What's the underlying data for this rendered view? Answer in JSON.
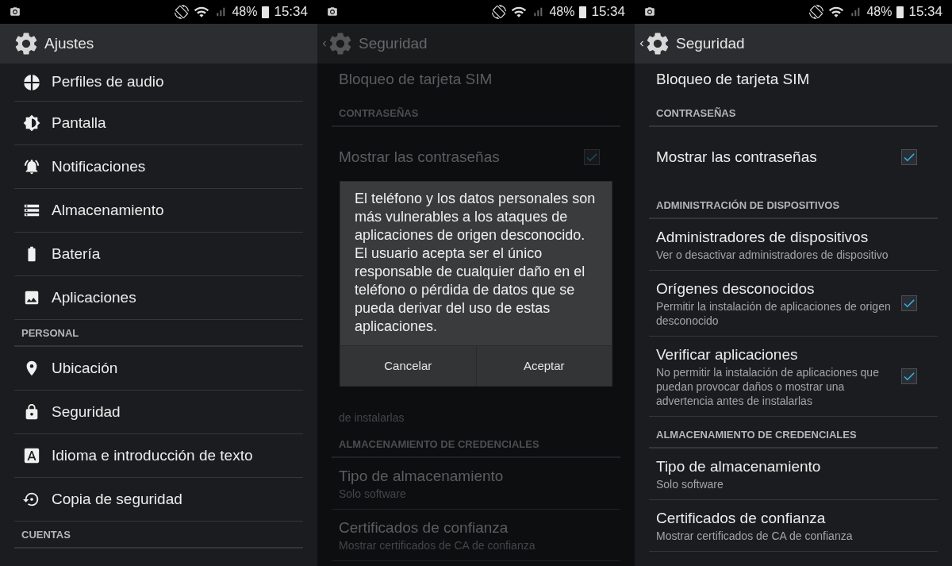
{
  "screens": [
    {
      "dimmed": false,
      "status_bar": {
        "battery": "48%",
        "time": "15:34"
      },
      "header": {
        "title": "Ajustes",
        "back": false
      },
      "items": [
        {
          "kind": "icon_row",
          "label": "Perfiles de audio"
        },
        {
          "kind": "icon_row",
          "label": "Pantalla"
        },
        {
          "kind": "icon_row",
          "label": "Notificaciones"
        },
        {
          "kind": "icon_row",
          "label": "Almacenamiento"
        },
        {
          "kind": "icon_row",
          "label": "Batería"
        },
        {
          "kind": "icon_row",
          "label": "Aplicaciones"
        },
        {
          "kind": "section",
          "label": "PERSONAL"
        },
        {
          "kind": "icon_row",
          "label": "Ubicación"
        },
        {
          "kind": "icon_row",
          "label": "Seguridad"
        },
        {
          "kind": "icon_row",
          "label": "Idioma e introducción de texto"
        },
        {
          "kind": "icon_row",
          "label": "Copia de seguridad"
        },
        {
          "kind": "section",
          "label": "CUENTAS"
        }
      ]
    },
    {
      "dimmed": true,
      "status_bar": {
        "battery": "48%",
        "time": "15:34"
      },
      "header": {
        "title": "Seguridad",
        "back": true
      },
      "items": [
        {
          "kind": "row",
          "label": "Bloqueo de tarjeta SIM"
        },
        {
          "kind": "section",
          "label": "CONTRASEÑAS"
        },
        {
          "kind": "check_row",
          "label": "Mostrar las contraseñas",
          "checked": true
        },
        {
          "kind": "fragment",
          "label": "de instalarlas"
        },
        {
          "kind": "section",
          "label": "ALMACENAMIENTO DE CREDENCIALES"
        },
        {
          "kind": "row",
          "label": "Tipo de almacenamiento",
          "summary": "Solo software"
        },
        {
          "kind": "row",
          "label": "Certificados de confianza",
          "summary": "Mostrar certificados de CA de confianza"
        }
      ],
      "dialog": {
        "message": "El teléfono y los datos personales son más vulnerables a los ataques de aplicaciones de origen desconocido. El usuario acepta ser el único responsable de cualquier daño en el teléfono o pérdida de datos que se pueda derivar del uso de estas aplicaciones.",
        "buttons": [
          "Cancelar",
          "Aceptar"
        ]
      }
    },
    {
      "dimmed": false,
      "status_bar": {
        "battery": "48%",
        "time": "15:34"
      },
      "header": {
        "title": "Seguridad",
        "back": true
      },
      "items": [
        {
          "kind": "row",
          "label": "Bloqueo de tarjeta SIM"
        },
        {
          "kind": "section",
          "label": "CONTRASEÑAS"
        },
        {
          "kind": "check_row",
          "label": "Mostrar las contraseñas",
          "checked": true
        },
        {
          "kind": "section",
          "label": "ADMINISTRACIÓN DE DISPOSITIVOS"
        },
        {
          "kind": "row",
          "label": "Administradores de dispositivos",
          "summary": "Ver o desactivar administradores de dispositivo"
        },
        {
          "kind": "check_row",
          "label": "Orígenes desconocidos",
          "summary": "Permitir la instalación de aplicaciones de origen desconocido",
          "checked": true
        },
        {
          "kind": "check_row",
          "label": "Verificar aplicaciones",
          "summary": "No permitir la instalación de aplicaciones que puedan provocar daños o mostrar una advertencia antes de instalarlas",
          "checked": true
        },
        {
          "kind": "section",
          "label": "ALMACENAMIENTO DE CREDENCIALES"
        },
        {
          "kind": "row",
          "label": "Tipo de almacenamiento",
          "summary": "Solo software"
        },
        {
          "kind": "row",
          "label": "Certificados de confianza",
          "summary": "Mostrar certificados de CA de confianza"
        }
      ]
    }
  ]
}
